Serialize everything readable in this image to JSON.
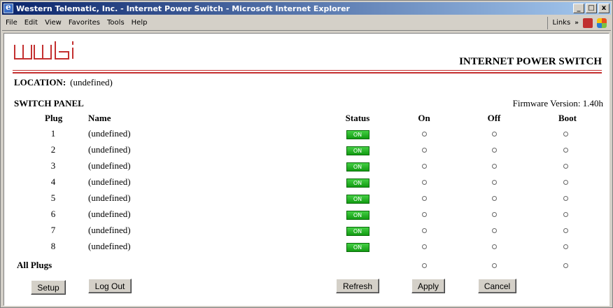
{
  "window": {
    "title": "Western Telematic, Inc. - Internet Power Switch - Microsoft Internet Explorer",
    "minimize": "_",
    "maximize": "□",
    "close": "x"
  },
  "menu": {
    "items": [
      "File",
      "Edit",
      "View",
      "Favorites",
      "Tools",
      "Help"
    ],
    "links_label": "Links",
    "links_chevron": "»"
  },
  "page": {
    "brand_title": "INTERNET POWER SWITCH",
    "location_label": "LOCATION:",
    "location_value": "(undefined)",
    "switch_panel_label": "SWITCH PANEL",
    "firmware": "Firmware Version: 1.40h",
    "accent_color": "#c43030"
  },
  "table": {
    "headers": {
      "plug": "Plug",
      "name": "Name",
      "status": "Status",
      "on": "On",
      "off": "Off",
      "boot": "Boot"
    },
    "rows": [
      {
        "plug": "1",
        "name": "(undefined)",
        "status": "ON"
      },
      {
        "plug": "2",
        "name": "(undefined)",
        "status": "ON"
      },
      {
        "plug": "3",
        "name": "(undefined)",
        "status": "ON"
      },
      {
        "plug": "4",
        "name": "(undefined)",
        "status": "ON"
      },
      {
        "plug": "5",
        "name": "(undefined)",
        "status": "ON"
      },
      {
        "plug": "6",
        "name": "(undefined)",
        "status": "ON"
      },
      {
        "plug": "7",
        "name": "(undefined)",
        "status": "ON"
      },
      {
        "plug": "8",
        "name": "(undefined)",
        "status": "ON"
      }
    ],
    "all_plugs_label": "All Plugs"
  },
  "buttons": {
    "setup": "Setup",
    "logout": "Log Out",
    "refresh": "Refresh",
    "apply": "Apply",
    "cancel": "Cancel"
  }
}
